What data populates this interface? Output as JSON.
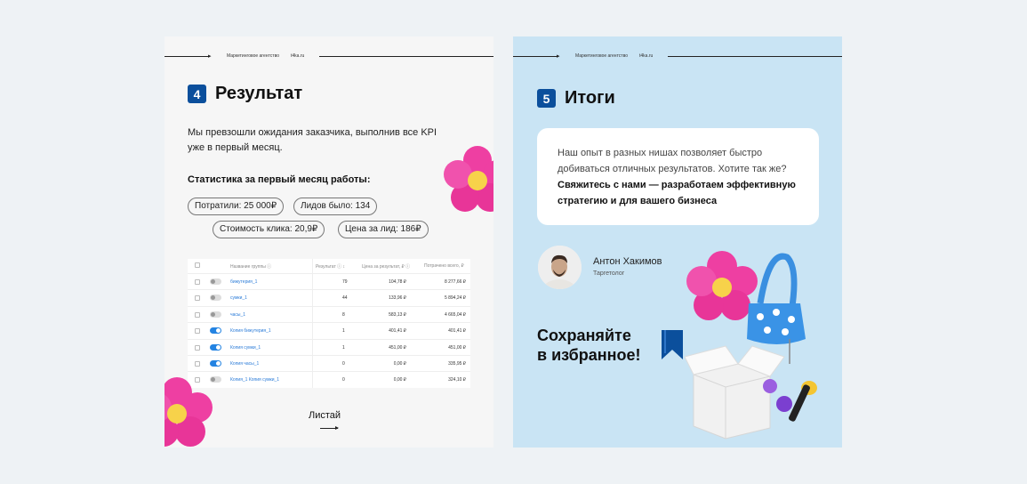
{
  "slide4": {
    "agency": "Маркетинговое агентство",
    "site": "t4ka.ru",
    "number": "4",
    "title": "Результат",
    "intro_line1": "Мы превзошли ожидания заказчика, выполнив все KPI",
    "intro_line2": "уже в первый месяц.",
    "stats_title": "Статистика за первый месяц работы:",
    "pills": [
      "Потратили: 25 000₽",
      "Лидов было: 134",
      "Стоимость клика: 20,9₽",
      "Цена за лид: 186₽"
    ],
    "table": {
      "headers": [
        "Название группы ⓘ",
        "Результат ⓘ ↕",
        "Цена за результат, ₽ ⓘ",
        "Потрачено всего, ₽"
      ],
      "rows": [
        {
          "name": "бижутерия_1",
          "on": false,
          "result": "79",
          "cost": "104,78 ₽",
          "spent": "8 277,66 ₽"
        },
        {
          "name": "сумки_1",
          "on": false,
          "result": "44",
          "cost": "133,96 ₽",
          "spent": "5 894,24 ₽"
        },
        {
          "name": "часы_1",
          "on": false,
          "result": "8",
          "cost": "583,13 ₽",
          "spent": "4 665,04 ₽"
        },
        {
          "name": "Копия бижутерия_1",
          "on": true,
          "result": "1",
          "cost": "401,41 ₽",
          "spent": "401,41 ₽"
        },
        {
          "name": "Копия сумки_1",
          "on": true,
          "result": "1",
          "cost": "451,00 ₽",
          "spent": "451,00 ₽"
        },
        {
          "name": "Копия часы_1",
          "on": true,
          "result": "0",
          "cost": "0,00 ₽",
          "spent": "335,95 ₽"
        },
        {
          "name": "Копия_1 Копия сумки_1",
          "on": false,
          "result": "0",
          "cost": "0,00 ₽",
          "spent": "324,10 ₽"
        }
      ]
    },
    "next_label": "Листай"
  },
  "slide5": {
    "agency": "Маркетинговое агентство",
    "site": "t4ka.ru",
    "number": "5",
    "title": "Итоги",
    "bubble_line1": "Наш опыт в разных нишах позволяет быстро",
    "bubble_line2": "добиваться отличных результатов. Хотите так же?",
    "bubble_bold1": "Свяжитесь с нами — разработаем эффективную",
    "bubble_bold2": "стратегию и для вашего бизнеса",
    "person_name": "Антон Хакимов",
    "person_role": "Таргетолог",
    "save_line1": "Сохраняйте",
    "save_line2": "в избранное!"
  },
  "colors": {
    "accent": "#0b4f9c",
    "flower": "#ee3fa2",
    "slide5_bg": "#c9e4f4",
    "toggle_on": "#2383e2"
  },
  "icons": [
    "flower-decoration",
    "bookmark-icon",
    "arrow-right-icon",
    "handbag-illustration",
    "box-illustration"
  ]
}
